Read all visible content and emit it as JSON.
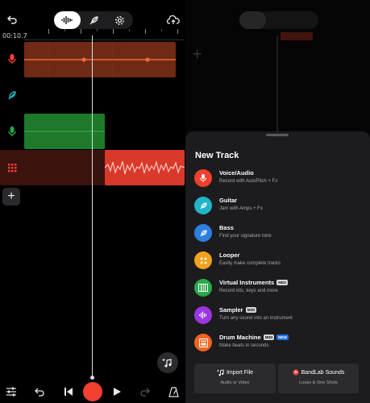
{
  "timeline": {
    "time_readout": "00:10.7",
    "ruler_labels": [
      "9",
      "10",
      "11",
      "12",
      "13",
      "14"
    ]
  },
  "colors": {
    "voice": "#f2402f",
    "voice_clip": "#6e2a14",
    "guitar": "#22b5c9",
    "bass": "#2d7fe0",
    "looper": "#f3a21f",
    "virtual_instruments": "#2aa84a",
    "sampler": "#9b36e0",
    "drum_machine": "#f06522",
    "green_clip": "#1e7a2a",
    "drum_clip": "#5c1a14",
    "drum_wave_clip": "#d9392b"
  },
  "left_toolbar": {
    "icons": [
      "back-icon",
      "waveform-icon",
      "feather-icon",
      "gear-icon",
      "cloud-upload-icon"
    ]
  },
  "bottom_bar": {
    "icons": [
      "mixer-icon",
      "undo-icon",
      "skip-back-icon",
      "record-icon",
      "play-icon",
      "redo-icon",
      "metronome-icon"
    ]
  },
  "sheet": {
    "title": "New Track",
    "items": [
      {
        "title": "Voice/Audio",
        "desc": "Record with AutoPitch + Fx",
        "icon": "mic-icon",
        "badges": []
      },
      {
        "title": "Guitar",
        "desc": "Jam with Amps + Fx",
        "icon": "guitar-icon",
        "badges": []
      },
      {
        "title": "Bass",
        "desc": "Find your signature tone",
        "icon": "bass-icon",
        "badges": []
      },
      {
        "title": "Looper",
        "desc": "Easily make complete tracks",
        "icon": "looper-icon",
        "badges": []
      },
      {
        "title": "Virtual Instruments",
        "desc": "Record kits, keys and more",
        "icon": "keyboard-icon",
        "badges": [
          "MIDI"
        ]
      },
      {
        "title": "Sampler",
        "desc": "Turn any sound into an instrument",
        "icon": "sampler-icon",
        "badges": [
          "MIDI"
        ]
      },
      {
        "title": "Drum Machine",
        "desc": "Make beats in seconds",
        "icon": "drum-machine-icon",
        "badges": [
          "MIDI",
          "NEW"
        ]
      }
    ],
    "import_file": {
      "title": "Import File",
      "desc": "Audio or Video"
    },
    "bandlab_sounds": {
      "title": "BandLab Sounds",
      "desc": "Loops & One Shots"
    }
  }
}
